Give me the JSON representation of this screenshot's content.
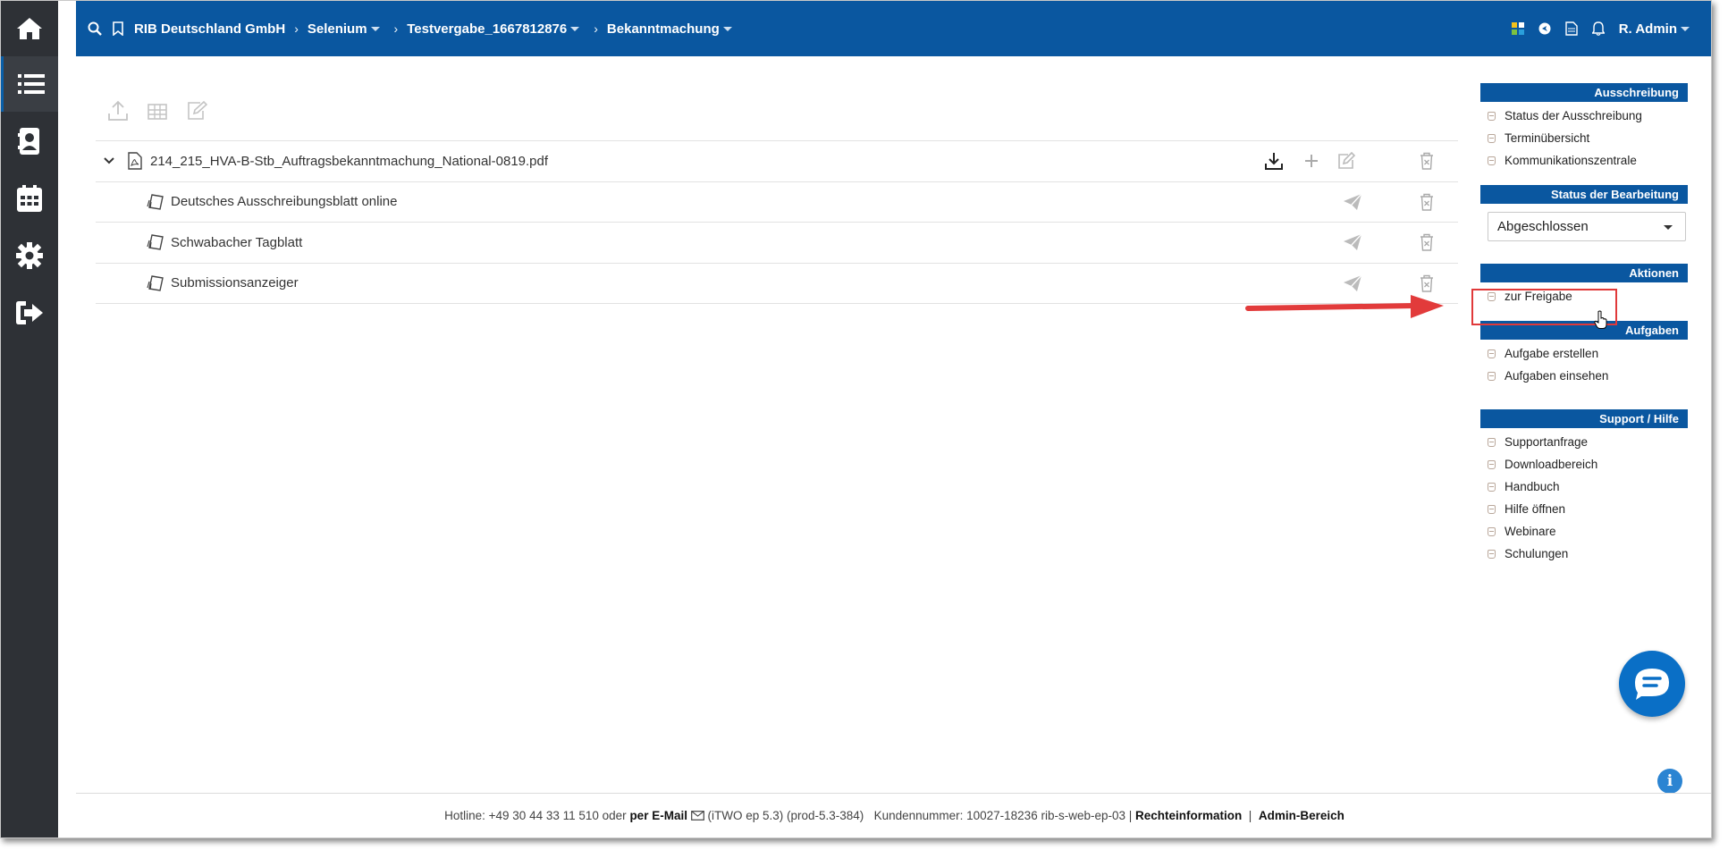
{
  "sidebar": {
    "items": [
      {
        "icon": "home-icon"
      },
      {
        "icon": "list-icon",
        "active": true
      },
      {
        "icon": "contacts-icon"
      },
      {
        "icon": "calendar-icon"
      },
      {
        "icon": "gear-icon"
      },
      {
        "icon": "logout-icon"
      }
    ]
  },
  "topbar": {
    "breadcrumb": [
      "RIB Deutschland GmbH",
      "Selenium",
      "Testvergabe_1667812876",
      "Bekanntmachung"
    ],
    "user": "R. Admin"
  },
  "toolbar": {
    "icons": [
      "upload-icon",
      "table-icon",
      "edit-icon"
    ]
  },
  "tree": {
    "file": "214_215_HVA-B-Stb_Auftragsbekanntmachung_National-0819.pdf",
    "children": [
      "Deutsches Ausschreibungsblatt online",
      "Schwabacher Tagblatt",
      "Submissionsanzeiger"
    ]
  },
  "panel": {
    "ausschreibung": {
      "title": "Ausschreibung",
      "items": [
        "Status der Ausschreibung",
        "Terminübersicht",
        "Kommunikationszentrale"
      ]
    },
    "bearbeitung": {
      "title": "Status der Bearbeitung",
      "selected": "Abgeschlossen"
    },
    "aktionen": {
      "title": "Aktionen",
      "items": [
        "zur Freigabe"
      ]
    },
    "aufgaben": {
      "title": "Aufgaben",
      "items": [
        "Aufgabe erstellen",
        "Aufgaben einsehen"
      ]
    },
    "support": {
      "title": "Support / Hilfe",
      "items": [
        "Supportanfrage",
        "Downloadbereich",
        "Handbuch",
        "Hilfe öffnen",
        "Webinare",
        "Schulungen"
      ]
    }
  },
  "footer": {
    "hotline": "Hotline: +49 30 44 33 11 510 oder",
    "email": "per E-Mail",
    "version": "(iTWO ep 5.3) (prod-5.3-384)",
    "customer": "Kundennummer: 10027-18236 rib-s-web-ep-03 |",
    "legal": "Rechteinformation",
    "divider": "|",
    "admin": "Admin-Bereich"
  },
  "colors": {
    "primary": "#0a57a0",
    "sidebar": "#2e3136",
    "highlight": "#e0393a"
  }
}
